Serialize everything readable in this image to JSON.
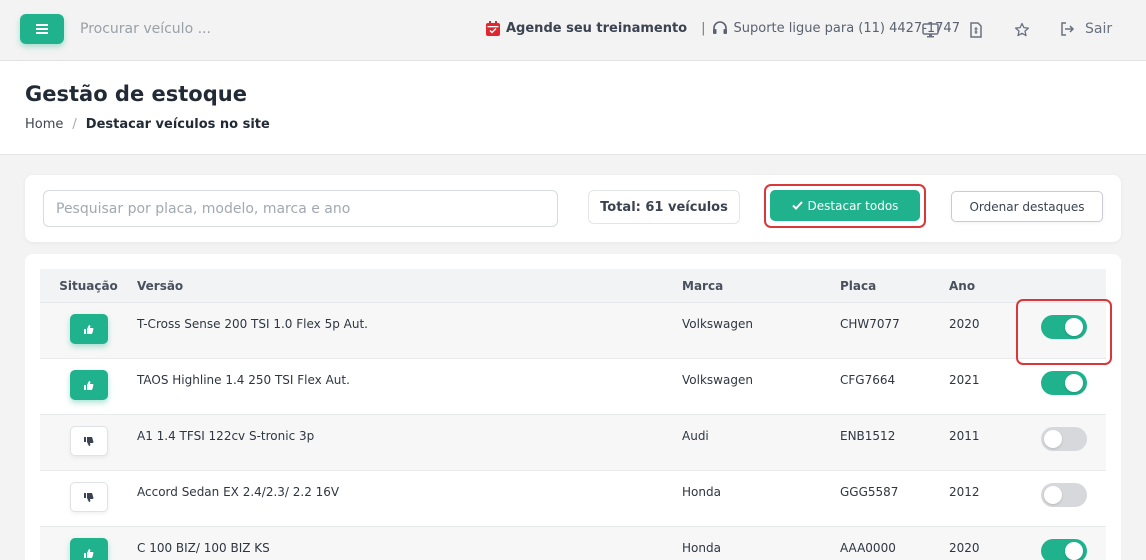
{
  "topbar": {
    "search_placeholder": "Procurar veículo ...",
    "training_label": "Agende seu treinamento",
    "separator": "|",
    "support_label": "Suporte ligue para (11) 4427-1747",
    "logout_label": "Sair",
    "icons": [
      "menu-icon",
      "calendar-icon",
      "headset-icon",
      "monitor-icon",
      "document-icon",
      "star-icon",
      "logout-icon"
    ]
  },
  "page": {
    "title": "Gestão de estoque",
    "breadcrumb": {
      "home": "Home",
      "separator": "/",
      "current": "Destacar veículos no site"
    }
  },
  "toolbar": {
    "search_placeholder": "Pesquisar por placa, modelo, marca e ano",
    "total_label": "Total: 61 veículos",
    "feature_all_label": "Destacar todos",
    "order_label": "Ordenar destaques"
  },
  "table": {
    "headers": {
      "situacao": "Situação",
      "versao": "Versão",
      "marca": "Marca",
      "placa": "Placa",
      "ano": "Ano"
    },
    "rows": [
      {
        "situacao": "up",
        "versao": "T-Cross Sense 200 TSI 1.0 Flex 5p Aut.",
        "marca": "Volkswagen",
        "placa": "CHW7077",
        "ano": "2020",
        "destaque": true
      },
      {
        "situacao": "up",
        "versao": "TAOS Highline 1.4 250 TSI Flex Aut.",
        "marca": "Volkswagen",
        "placa": "CFG7664",
        "ano": "2021",
        "destaque": true
      },
      {
        "situacao": "down",
        "versao": "A1 1.4 TFSI 122cv S-tronic 3p",
        "marca": "Audi",
        "placa": "ENB1512",
        "ano": "2011",
        "destaque": false
      },
      {
        "situacao": "down",
        "versao": "Accord Sedan EX 2.4/2.3/ 2.2 16V",
        "marca": "Honda",
        "placa": "GGG5587",
        "ano": "2012",
        "destaque": false
      },
      {
        "situacao": "up",
        "versao": "C 100 BIZ/ 100 BIZ KS",
        "marca": "Honda",
        "placa": "AAA0000",
        "ano": "2020",
        "destaque": true
      }
    ]
  },
  "colors": {
    "accent": "#1fb28d",
    "highlight": "#d9383a",
    "toggle_off": "#d6d8dc"
  }
}
